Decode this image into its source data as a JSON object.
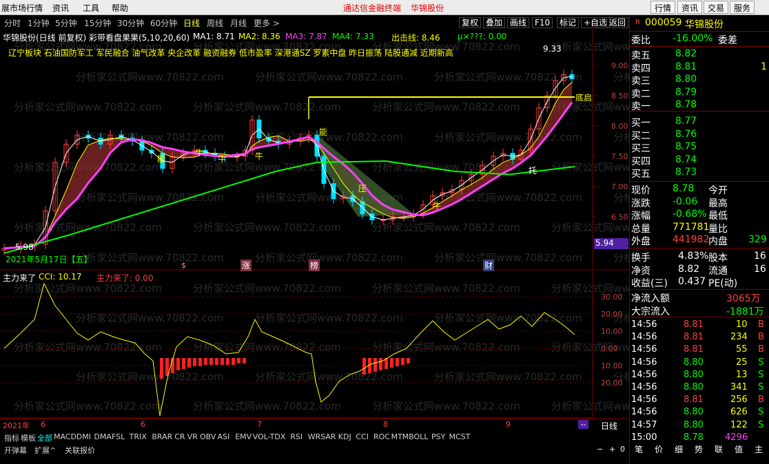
{
  "menubar": {
    "items": [
      "展市场行情",
      "资讯",
      "工具",
      "帮助"
    ],
    "center_title": "通达信金融终端",
    "stock_name": "华锦股份",
    "buttons": [
      "行情",
      "资讯",
      "交易",
      "服务"
    ]
  },
  "timeframes": [
    "分时",
    "1分钟",
    "5分钟",
    "15分钟",
    "30分钟",
    "60分钟",
    "日线",
    "周线",
    "月线",
    "更多 >"
  ],
  "active_timeframe": "日线",
  "toolbar_buttons": [
    "复权",
    "叠加",
    "画线",
    "F10",
    "标记",
    "+自选",
    "返回"
  ],
  "chart_header": {
    "title": "华锦股份(日线 前复权) 彩带看盘果果(5,10,20,60)",
    "ma1": "MA1: 8.71",
    "ma2": "MA2: 8.36",
    "ma3": "MA3: 7.87",
    "ma4": "MA4: 7.33",
    "exit_line": "出击线: 8.46",
    "mu": "μ×???: 0.00"
  },
  "concepts": "辽宁板块 石油国防军工 军民融合 油气改革 央企改革 融资融券 低市盈率 深港通SZ 罗素中盘 昨日振荡 陆股通减 近期新高",
  "price_axis": [
    "9.00",
    "8.50",
    "8.00",
    "7.50",
    "7.00",
    "6.50"
  ],
  "price_marker": "5.94",
  "high_label": "9.33",
  "low_label": "5.98",
  "bottom_label": "底启",
  "date_label": "2021年5月17日【五】",
  "event_markers": [
    "$",
    "涨",
    "榜",
    "财"
  ],
  "chart_annotations": [
    "能",
    "牛",
    "牛",
    "牛",
    "能",
    "压",
    "牛",
    "托",
    "牛"
  ],
  "indicator": {
    "name": "主力来了",
    "cci": "CCI: 10.17",
    "main": "主力来了: 0.00",
    "axis": [
      "30.00",
      "20.00",
      "10.00",
      "0.00",
      "10.00",
      "20.00"
    ]
  },
  "x_axis": [
    "2021年",
    "6",
    "6",
    "7",
    "8",
    "9"
  ],
  "period_label": "日线",
  "indicator_tabs": [
    "指标",
    "模板",
    "全部",
    "MACD",
    "DMI",
    "DMA",
    "FSL",
    "TRIX",
    "BRAR",
    "CR",
    "VR",
    "OBV",
    "ASI",
    "EMV",
    "VOL-TDX",
    "RSI",
    "WR",
    "SAR",
    "KDJ",
    "CCI",
    "ROC",
    "MTM",
    "BOLL",
    "PSY",
    "MCST"
  ],
  "bottom_items": [
    "开弹幕",
    "扩展^",
    "关联报价"
  ],
  "watermark": "分析家公式网www.70822.com",
  "quote": {
    "badge": "R",
    "code": "000059",
    "name": "华锦股份",
    "wei_bi_label": "委比",
    "wei_bi": "-16.00%",
    "wei_cha_label": "委差",
    "asks": [
      {
        "label": "卖五",
        "price": "8.82",
        "vol": ""
      },
      {
        "label": "卖四",
        "price": "8.81",
        "vol": "1"
      },
      {
        "label": "卖三",
        "price": "8.80",
        "vol": ""
      },
      {
        "label": "卖二",
        "price": "8.79",
        "vol": ""
      },
      {
        "label": "卖一",
        "price": "8.78",
        "vol": ""
      }
    ],
    "bids": [
      {
        "label": "买一",
        "price": "8.77"
      },
      {
        "label": "买二",
        "price": "8.76"
      },
      {
        "label": "买三",
        "price": "8.75"
      },
      {
        "label": "买四",
        "price": "8.74"
      },
      {
        "label": "买五",
        "price": "8.73"
      }
    ],
    "stats": [
      {
        "l": "现价",
        "v": "8.78",
        "l2": "今开",
        "c": "#00ff00"
      },
      {
        "l": "涨跌",
        "v": "-0.06",
        "l2": "最高",
        "c": "#00ff00"
      },
      {
        "l": "涨幅",
        "v": "-0.68%",
        "l2": "最低",
        "c": "#00ff00"
      },
      {
        "l": "总量",
        "v": "771781",
        "l2": "量比",
        "c": "#ffff00"
      },
      {
        "l": "外盘",
        "v": "441982",
        "l2": "内盘",
        "c": "#ff4040",
        "v2": "329"
      }
    ],
    "stats2": [
      {
        "l": "换手",
        "v": "4.83%",
        "l2": "股本",
        "v2": "16"
      },
      {
        "l": "净资",
        "v": "8.82",
        "l2": "流通",
        "v2": "16"
      },
      {
        "l": "收益(三)",
        "v": "0.437",
        "l2": "PE(动)",
        "v2": ""
      }
    ],
    "flow": [
      {
        "l": "净流入额",
        "v": "3065万",
        "c": "#ff4040"
      },
      {
        "l": "大宗流入",
        "v": "-1881万",
        "c": "#00ff00"
      }
    ],
    "ticks": [
      {
        "t": "14:56",
        "p": "8.81",
        "v": "10",
        "s": "B"
      },
      {
        "t": "14:56",
        "p": "8.81",
        "v": "234",
        "s": "B"
      },
      {
        "t": "14:56",
        "p": "8.81",
        "v": "55",
        "s": "B"
      },
      {
        "t": "14:56",
        "p": "8.80",
        "v": "25",
        "s": "S"
      },
      {
        "t": "14:56",
        "p": "8.80",
        "v": "13",
        "s": "S"
      },
      {
        "t": "14:56",
        "p": "8.80",
        "v": "341",
        "s": "S"
      },
      {
        "t": "14:56",
        "p": "8.81",
        "v": "256",
        "s": "B"
      },
      {
        "t": "14:56",
        "p": "8.80",
        "v": "626",
        "s": "S"
      },
      {
        "t": "14:57",
        "p": "8.80",
        "v": "122",
        "s": "S"
      },
      {
        "t": "15:00",
        "p": "8.78",
        "v": "4296",
        "s": ""
      }
    ],
    "tabs": [
      "笔",
      "价",
      "细",
      "势",
      "联",
      "值",
      "主"
    ]
  }
}
